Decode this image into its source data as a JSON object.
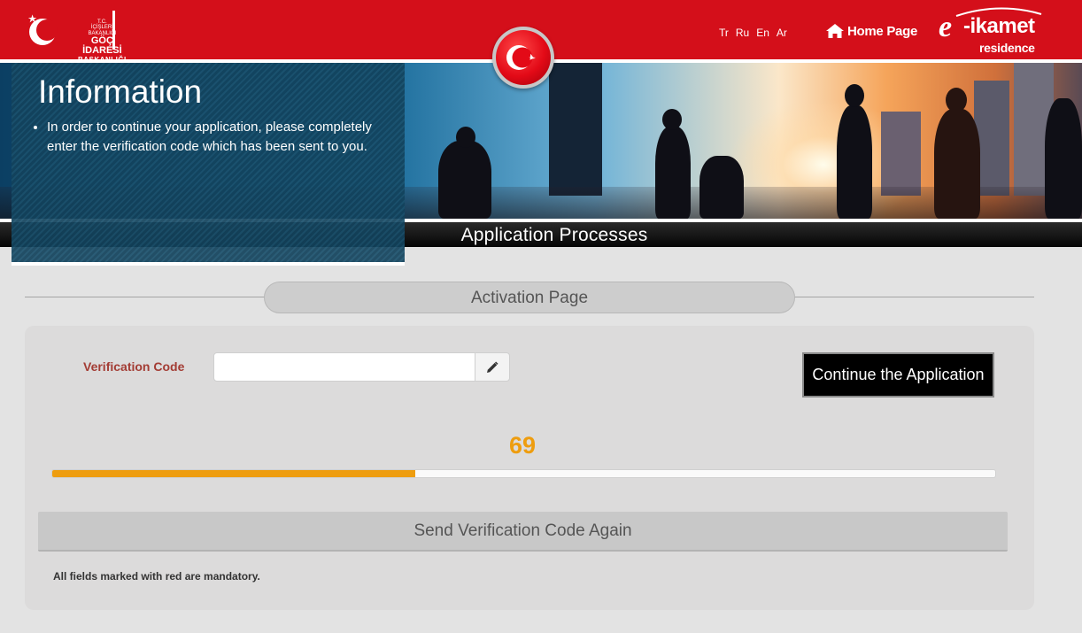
{
  "header": {
    "org_logo_lines": [
      "T.C.",
      "İÇİŞLERİ BAKANLIĞI",
      "GÖÇ İDARESİ",
      "BAŞKANLIĞI"
    ],
    "languages": [
      "Tr",
      "Ru",
      "En",
      "Ar"
    ],
    "home_label": "Home Page",
    "brand": {
      "e": "e",
      "word": "-ikamet",
      "sub": "residence"
    }
  },
  "info": {
    "title": "Information",
    "bullets": [
      "In order to continue your application, please completely enter the verification code which has been sent to you."
    ]
  },
  "banner": {
    "band_title": "Application Processes"
  },
  "section": {
    "title": "Activation Page"
  },
  "form": {
    "verification_label": "Verification Code",
    "verification_value": "",
    "verification_placeholder": "",
    "continue_label": "Continue the Application",
    "countdown": "69",
    "progress_fraction": 0.385,
    "resend_label": "Send Verification Code Again",
    "mandatory_note": "All fields marked with red are mandatory."
  },
  "colors": {
    "header_red": "#d40f1a",
    "accent_orange": "#ee9d0f",
    "label_red": "#a33c34"
  },
  "icons": [
    "crescent-star-logo-icon",
    "home-icon",
    "turkish-flag-icon",
    "pencil-icon"
  ]
}
